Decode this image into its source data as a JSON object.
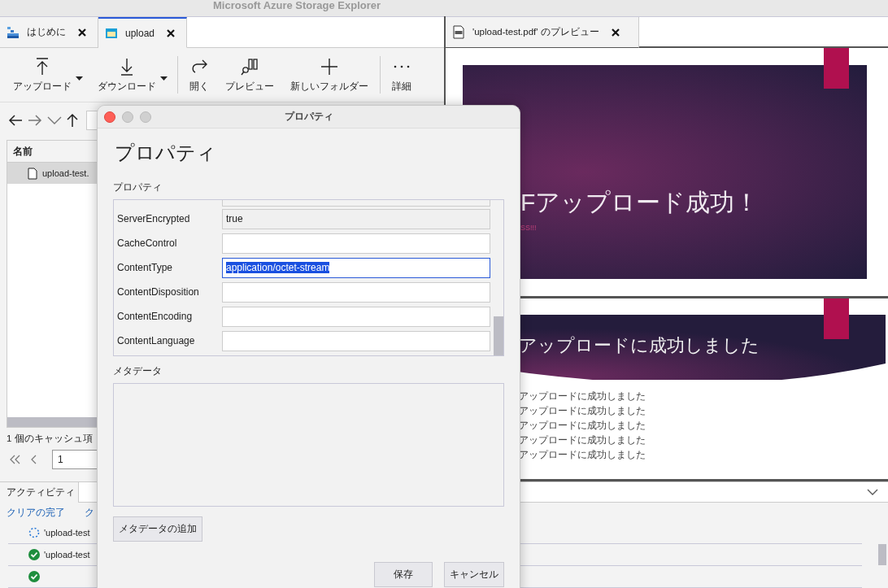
{
  "window": {
    "title": "Microsoft Azure Storage Explorer"
  },
  "tabs": [
    {
      "label": "はじめに",
      "selected": false
    },
    {
      "label": "upload",
      "selected": true
    }
  ],
  "preview_tab": {
    "label": "'upload-test.pdf' のプレビュー"
  },
  "toolbar": [
    [
      {
        "label": "アップロード",
        "dropdown": true
      },
      {
        "label": "ダウンロード",
        "dropdown": true
      }
    ],
    [
      {
        "label": "開く",
        "dropdown": false
      },
      {
        "label": "プレビュー",
        "dropdown": false
      },
      {
        "label": "新しいフォルダー",
        "dropdown": false
      }
    ],
    [
      {
        "label": "詳細",
        "dropdown": false
      }
    ]
  ],
  "table": {
    "columns": [
      "名前"
    ],
    "rows": [
      {
        "name": "upload-test.",
        "selected": true
      }
    ]
  },
  "status": "1 個のキャッシュ項",
  "pager": {
    "page": "1"
  },
  "activity": {
    "tab": "アクティビティ",
    "links": [
      "クリアの完了",
      "ク"
    ],
    "items": [
      {
        "kind": "running",
        "text": "'upload-test"
      },
      {
        "kind": "success",
        "text": "'upload-test"
      },
      {
        "kind": "success"
      }
    ]
  },
  "preview": {
    "slides": [
      {
        "kind": "title",
        "title": "Fアップロード成功！",
        "subtitle": "SS!!!"
      },
      {
        "kind": "content",
        "title": "アップロードに成功しました",
        "bullets": [
          "アップロードに成功しました",
          "アップロードに成功しました",
          "アップロードに成功しました",
          "アップロードに成功しました",
          "アップロードに成功しました"
        ]
      }
    ]
  },
  "dialog": {
    "title": "プロパティ",
    "heading": "プロパティ",
    "section": "プロパティ",
    "properties": [
      {
        "name": "ServerEncrypted",
        "value": "true",
        "kind": "readonly"
      },
      {
        "name": "CacheControl",
        "kind": "editable"
      },
      {
        "name": "ContentType",
        "value": "application/octet-stream",
        "kind": "focused"
      },
      {
        "name": "ContentDisposition",
        "kind": "editable"
      },
      {
        "name": "ContentEncoding",
        "kind": "editable"
      },
      {
        "name": "ContentLanguage",
        "kind": "editable"
      }
    ],
    "metadata_label": "メタデータ",
    "add_button": "メタデータの追加",
    "buttons": [
      "保存",
      "キャンセル"
    ]
  }
}
